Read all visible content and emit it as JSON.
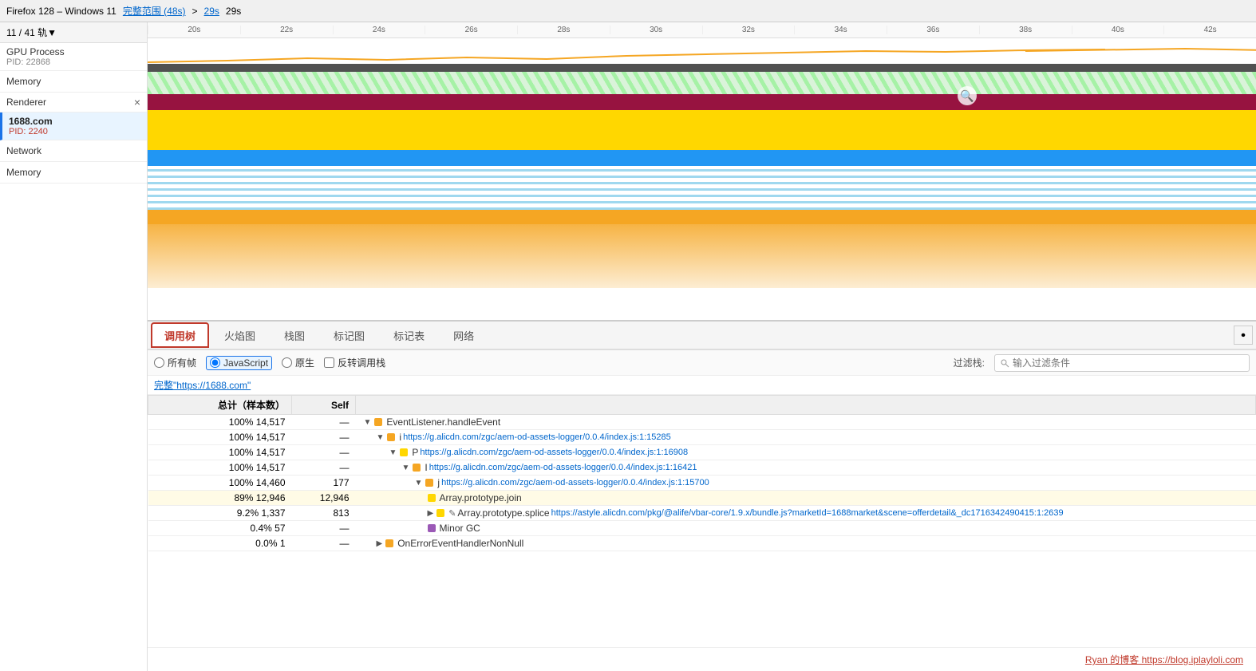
{
  "topbar": {
    "title": "Firefox 128 – Windows 11",
    "range_label": "完整范围 (48s)",
    "link1": "29s",
    "sep": ">",
    "link2": "29s"
  },
  "sidebar": {
    "thread_count": "11 / 41 轨",
    "dropdown_icon": "▼",
    "gpu_process": {
      "name": "GPU Process",
      "pid": "PID: 22868"
    },
    "memory_label": "Memory",
    "renderer_label": "Renderer",
    "close_icon": "×",
    "site": {
      "name": "1688.com",
      "pid": "PID: 2240"
    },
    "network_label": "Network",
    "memory2_label": "Memory"
  },
  "ruler": {
    "ticks": [
      "20s",
      "22s",
      "24s",
      "26s",
      "28s",
      "30s",
      "32s",
      "34s",
      "36s",
      "38s",
      "40s",
      "42s"
    ]
  },
  "tabs": [
    {
      "id": "calltree",
      "label": "调用树",
      "active": true
    },
    {
      "id": "flame",
      "label": "火焰图",
      "active": false
    },
    {
      "id": "stack",
      "label": "栈图",
      "active": false
    },
    {
      "id": "markerChart",
      "label": "标记图",
      "active": false
    },
    {
      "id": "markerTable",
      "label": "标记表",
      "active": false
    },
    {
      "id": "network",
      "label": "网络",
      "active": false
    }
  ],
  "filter_bar": {
    "radio_all_label": "所有帧",
    "radio_js_label": "JavaScript",
    "radio_native_label": "原生",
    "checkbox_invert": "反转调用栈",
    "filter_prefix": "过滤栈:",
    "filter_placeholder": "输入过滤条件"
  },
  "breadcrumb": "完整\"https://1688.com\"",
  "table": {
    "headers": [
      "总计（样本数）",
      "Self",
      ""
    ],
    "rows": [
      {
        "pct": "100%",
        "samples": "14,517",
        "self": "—",
        "indent": 0,
        "arrow": "▼",
        "icon": "orange",
        "name": "EventListener.handleEvent",
        "link": ""
      },
      {
        "pct": "100%",
        "samples": "14,517",
        "self": "—",
        "indent": 1,
        "arrow": "▼",
        "icon": "orange",
        "name": "i",
        "link": "https://g.alicdn.com/zgc/aem-od-assets-logger/0.0.4/index.js:1:15285"
      },
      {
        "pct": "100%",
        "samples": "14,517",
        "self": "—",
        "indent": 2,
        "arrow": "▼",
        "icon": "yellow",
        "name": "P",
        "link": "https://g.alicdn.com/zgc/aem-od-assets-logger/0.0.4/index.js:1:16908"
      },
      {
        "pct": "100%",
        "samples": "14,517",
        "self": "—",
        "indent": 3,
        "arrow": "▼",
        "icon": "orange",
        "name": "I",
        "link": "https://g.alicdn.com/zgc/aem-od-assets-logger/0.0.4/index.js:1:16421"
      },
      {
        "pct": "100%",
        "samples": "14,460",
        "self": "177",
        "indent": 4,
        "arrow": "▼",
        "icon": "orange",
        "name": "j",
        "link": "https://g.alicdn.com/zgc/aem-od-assets-logger/0.0.4/index.js:1:15700"
      },
      {
        "pct": "89%",
        "samples": "12,946",
        "self": "12,946",
        "indent": 5,
        "arrow": "",
        "icon": "yellow",
        "name": "Array.prototype.join",
        "link": "",
        "highlight": true
      },
      {
        "pct": "9.2%",
        "samples": "1,337",
        "self": "813",
        "indent": 5,
        "arrow": "▶",
        "icon": "yellow",
        "name": "Array.prototype.splice",
        "link": "https://astyle.alicdn.com/pkg/@alife/vbar-core/1.9.x/bundle.js?marketId=1688market&scene=offerdetail&_dc1716342490415:1:2639",
        "edit": true
      },
      {
        "pct": "0.4%",
        "samples": "57",
        "self": "—",
        "indent": 5,
        "arrow": "",
        "icon": "purple",
        "name": "Minor GC",
        "link": ""
      },
      {
        "pct": "0.0%",
        "samples": "1",
        "self": "—",
        "indent": 1,
        "arrow": "▶",
        "icon": "orange",
        "name": "OnErrorEventHandlerNonNull",
        "link": ""
      }
    ]
  },
  "footer": {
    "text": "Ryan 的博客 https://blog.iplayloli.com"
  }
}
